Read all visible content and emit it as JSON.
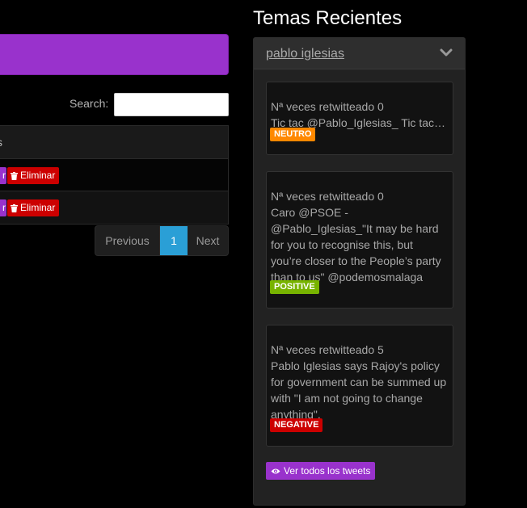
{
  "left": {
    "search_label": "Search:",
    "search_value": "",
    "table_header_fragment": "s",
    "rows": [
      {
        "edit_fragment": "r",
        "delete_label": "Eliminar"
      },
      {
        "edit_fragment": "r",
        "delete_label": "Eliminar"
      }
    ],
    "pagination": {
      "previous": "Previous",
      "current": "1",
      "next": "Next"
    }
  },
  "right": {
    "title": "Temas Recientes",
    "topic": "pablo iglesias",
    "tweets": [
      {
        "count": "Nª veces retwitteado 0",
        "text": "Tic tac @Pablo_Iglesias_ Tic tac…",
        "sentiment": "NEUTRO"
      },
      {
        "count": "Nª veces retwitteado 0",
        "text": "Caro @PSOE -\n@Pablo_Iglesias_\"It may be hard\nfor you to recognise this, but\nyou’re closer to the People’s party\nthan to us\" @podemosmalaga",
        "sentiment": "POSITIVE"
      },
      {
        "count": "Nª veces retwitteado 5",
        "text": "Pablo Iglesias says Rajoy's policy\nfor government can be summed up\nwith \"I am not going to change\nanything\".",
        "sentiment": "NEGATIVE"
      }
    ],
    "view_all": "Ver todos los tweets"
  },
  "colors": {
    "accent_purple": "#9932CC",
    "danger": "#cc0000",
    "primary": "#2a9fd6",
    "neutral_badge": "#ff8800",
    "positive_badge": "#77b300"
  },
  "icons": [
    "trash-icon",
    "chevron-down-icon",
    "eye-icon"
  ]
}
